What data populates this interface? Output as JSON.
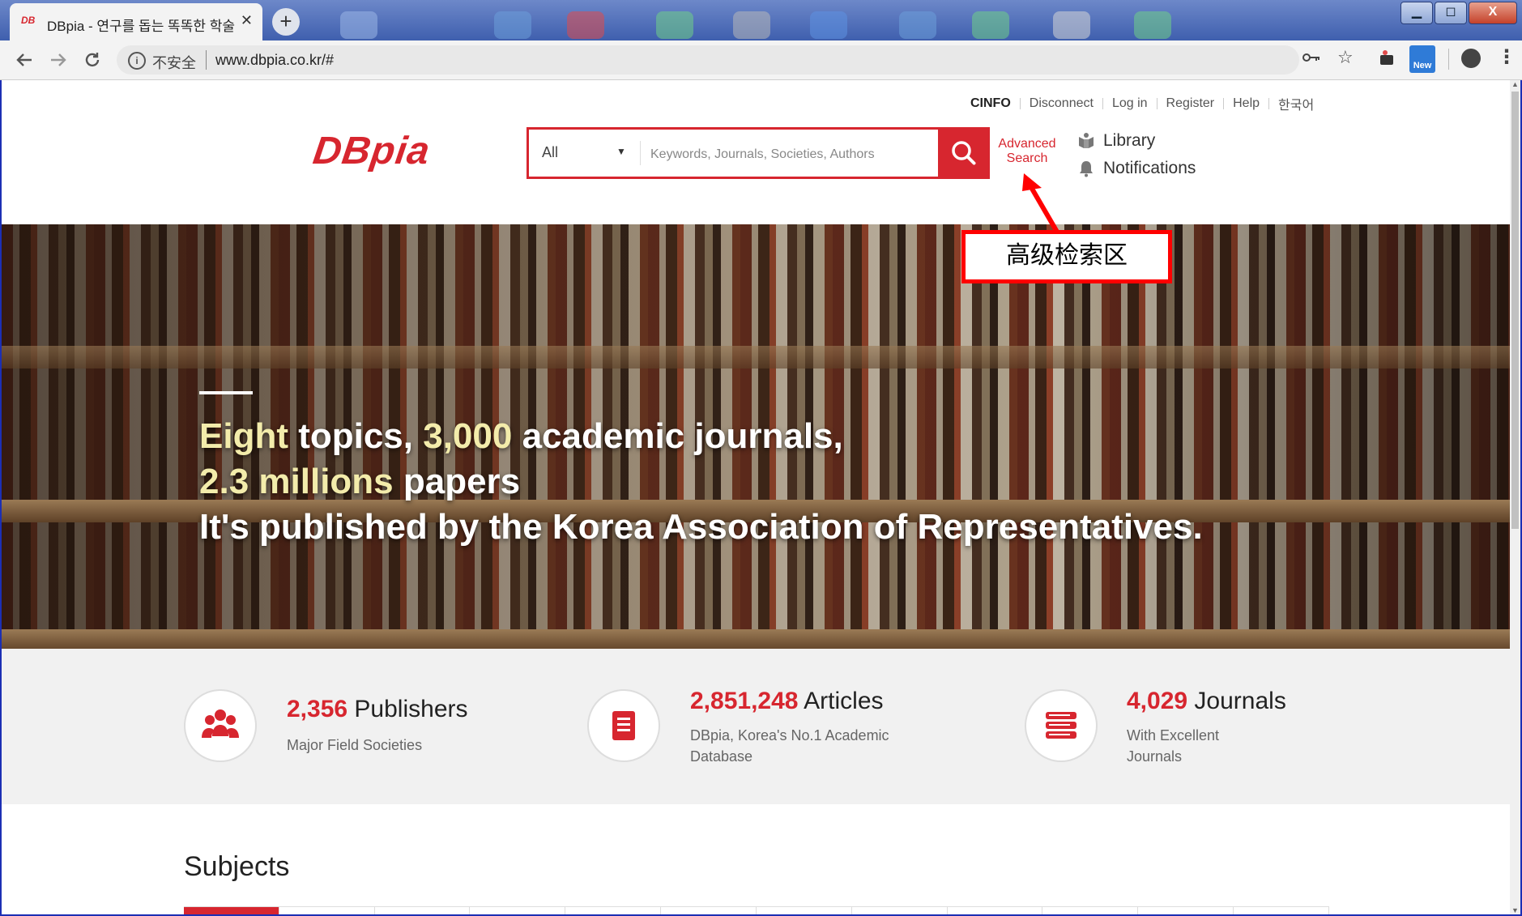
{
  "browser": {
    "tab_title": "DBpia - 연구를 돕는 똑똑한 학술",
    "tab_favicon": "DB",
    "tab_close": "✕",
    "new_tab": "+",
    "insecure_label": "不安全",
    "url": "www.dbpia.co.kr/#",
    "ext_new_badge": "New",
    "window_controls": [
      "▁",
      "◻",
      "X"
    ]
  },
  "header": {
    "links": {
      "cinfo": "CINFO",
      "disconnect": "Disconnect",
      "login": "Log in",
      "register": "Register",
      "help": "Help",
      "korean": "한국어"
    },
    "logo": "DBpia",
    "search": {
      "scope": "All",
      "placeholder": "Keywords, Journals, Societies, Authors"
    },
    "advanced_search_1": "Advanced",
    "advanced_search_2": "Search",
    "library": "Library",
    "notifications": "Notifications"
  },
  "hero": {
    "line1_a": "Eight",
    "line1_b": " topics, ",
    "line1_c": "3,000",
    "line1_d": " academic journals,",
    "line2_a": "2.3 millions",
    "line2_b": " papers",
    "line3": "It's published by the Korea Association of Representatives.",
    "pause": "II"
  },
  "annotation": {
    "label": "高级检索区"
  },
  "stats": {
    "publishers": {
      "count": "2,356",
      "label": "Publishers",
      "desc": "Major Field Societies"
    },
    "articles": {
      "count": "2,851,248",
      "label": "Articles",
      "desc1": "DBpia, Korea's No.1 Academic",
      "desc2": "Database"
    },
    "journals": {
      "count": "4,029",
      "label": "Journals",
      "desc1": "With Excellent",
      "desc2": "Journals"
    }
  },
  "subjects": {
    "title": "Subjects"
  },
  "colors": {
    "brand": "#d7262f",
    "hero_highlight": "#f3ecab",
    "annotation": "#ff0000"
  }
}
